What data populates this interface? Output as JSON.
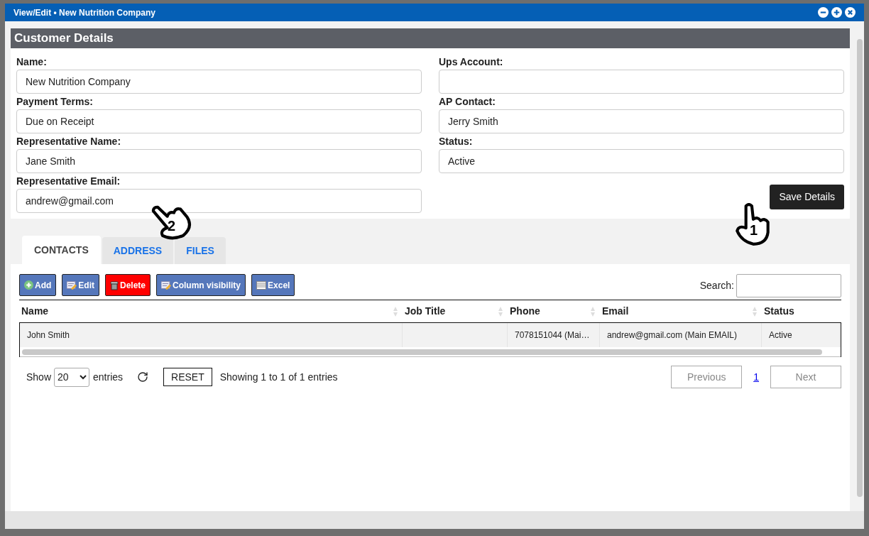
{
  "window": {
    "title": "View/Edit • New Nutrition Company"
  },
  "section_title": "Customer Details",
  "fields_left": [
    {
      "label": "Name:",
      "value": "New Nutrition Company"
    },
    {
      "label": "Payment Terms:",
      "value": "Due on Receipt"
    },
    {
      "label": "Representative Name:",
      "value": "Jane Smith"
    },
    {
      "label": "Representative Email:",
      "value": "andrew@gmail.com"
    }
  ],
  "fields_right": [
    {
      "label": "Ups Account:"
    },
    {
      "label": "AP Contact:",
      "value": "Jerry Smith"
    },
    {
      "label": "Status:",
      "value": "Active"
    }
  ],
  "save_button": "Save Details",
  "tabs": [
    {
      "label": "CONTACTS",
      "selected": true
    },
    {
      "label": "ADDRESS",
      "selected": false
    },
    {
      "label": "FILES",
      "selected": false
    }
  ],
  "toolbar": [
    {
      "label": "Add",
      "kind": "add"
    },
    {
      "label": "Edit",
      "kind": "edit"
    },
    {
      "label": "Delete",
      "kind": "delete"
    },
    {
      "label": "Column visibility",
      "kind": "columns"
    },
    {
      "label": "Excel",
      "kind": "excel"
    }
  ],
  "search": {
    "label": "Search:"
  },
  "table": {
    "columns": [
      "Name",
      "Job Title",
      "Phone",
      "Email",
      "Status"
    ],
    "rows": [
      [
        "John Smith",
        "",
        "7078151044 (Mai…",
        "andrew@gmail.com (Main EMAIL)",
        "Active"
      ]
    ]
  },
  "footer": {
    "show": "Show",
    "page_size": "20",
    "entries": "entries",
    "reset": "RESET",
    "info": "Showing 1 to 1 of 1 entries",
    "previous": "Previous",
    "page": "1",
    "next": "Next"
  },
  "annotations": [
    {
      "label": "1"
    },
    {
      "label": "2"
    }
  ]
}
